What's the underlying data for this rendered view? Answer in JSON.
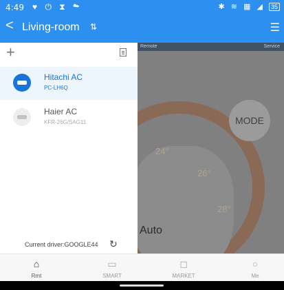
{
  "status_bar": {
    "time": "4:49",
    "icons_left": "♥ ⏻ ⧗ ☁",
    "icons_right": "✱ ≋ ▦ ◢",
    "battery": "35"
  },
  "header": {
    "back_label": "<",
    "title": "Living-room",
    "sort_symbol": "⇅",
    "menu_symbol": "☰"
  },
  "background": {
    "bar_left": "Remote",
    "bar_right": "Service",
    "mode_label": "MODE",
    "temps": [
      "24°",
      "26°",
      "28°"
    ],
    "mode_value": "Auto"
  },
  "drawer": {
    "add_symbol": "+",
    "devices": [
      {
        "name": "Hitachi AC",
        "model": "PC-LH6Q",
        "selected": true
      },
      {
        "name": "Haier AC",
        "model": "KFR-26G/SAG11",
        "selected": false
      }
    ],
    "footer": "Current driver:GOOGLE44",
    "refresh_symbol": "↻"
  },
  "bottom_nav": [
    {
      "label": "Rmt",
      "icon": "remote-icon",
      "glyph": "⌂",
      "active": true
    },
    {
      "label": "SMART",
      "icon": "smart-icon",
      "glyph": "▭",
      "active": false
    },
    {
      "label": "MARKET",
      "icon": "market-icon",
      "glyph": "◻",
      "active": false
    },
    {
      "label": "Me",
      "icon": "me-icon",
      "glyph": "○",
      "active": false
    }
  ],
  "colors": {
    "primary": "#2d8ff0",
    "device_selected": "#1a73d9",
    "device_unselected": "#bfc3c7"
  }
}
